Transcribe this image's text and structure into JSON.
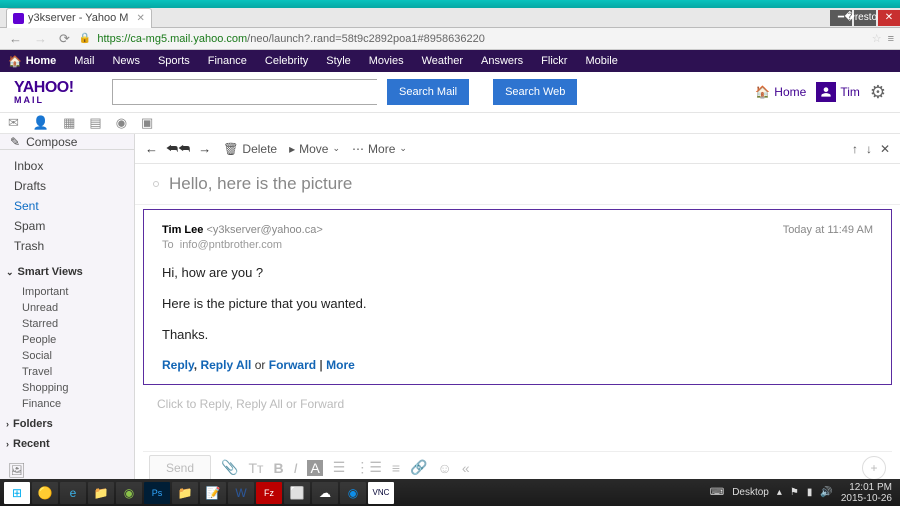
{
  "browser": {
    "tab_title": "y3kserver - Yahoo M",
    "url_secure": "https://",
    "url_host": "ca-mg5.mail.yahoo.com",
    "url_path": "/neo/launch?.rand=58t9c2892poa1#8958636220"
  },
  "yahoo_nav": [
    "Home",
    "Mail",
    "News",
    "Sports",
    "Finance",
    "Celebrity",
    "Style",
    "Movies",
    "Weather",
    "Answers",
    "Flickr",
    "Mobile"
  ],
  "header": {
    "logo_top": "YAHOO!",
    "logo_bottom": "MAIL",
    "search_mail": "Search Mail",
    "search_web": "Search Web",
    "home": "Home",
    "user": "Tim"
  },
  "compose": "Compose",
  "folders": [
    {
      "label": "Inbox"
    },
    {
      "label": "Drafts"
    },
    {
      "label": "Sent",
      "selected": true
    },
    {
      "label": "Spam"
    },
    {
      "label": "Trash"
    }
  ],
  "smart_views_hdr": "Smart Views",
  "smart_views": [
    "Important",
    "Unread",
    "Starred",
    "People",
    "Social",
    "Travel",
    "Shopping",
    "Finance"
  ],
  "sections": [
    {
      "label": "Folders"
    },
    {
      "label": "Recent"
    }
  ],
  "toolbar": {
    "delete": "Delete",
    "move": "Move",
    "more": "More"
  },
  "subject": "Hello, here is the picture",
  "message": {
    "from_name": "Tim Lee",
    "from_email": "<y3kserver@yahoo.ca>",
    "to_label": "To",
    "to_email": "info@pntbrother.com",
    "date": "Today at 11:49 AM",
    "body": [
      "Hi, how are you ?",
      "Here is the picture that you wanted.",
      "Thanks."
    ],
    "links": {
      "reply": "Reply",
      "reply_all": "Reply All",
      "or": "or",
      "forward": "Forward",
      "sep": "|",
      "more": "More"
    }
  },
  "quick_reply": "Click to Reply, Reply All or Forward",
  "send": "Send",
  "tray": {
    "desktop": "Desktop",
    "time": "12:01 PM",
    "date": "2015-10-26"
  }
}
